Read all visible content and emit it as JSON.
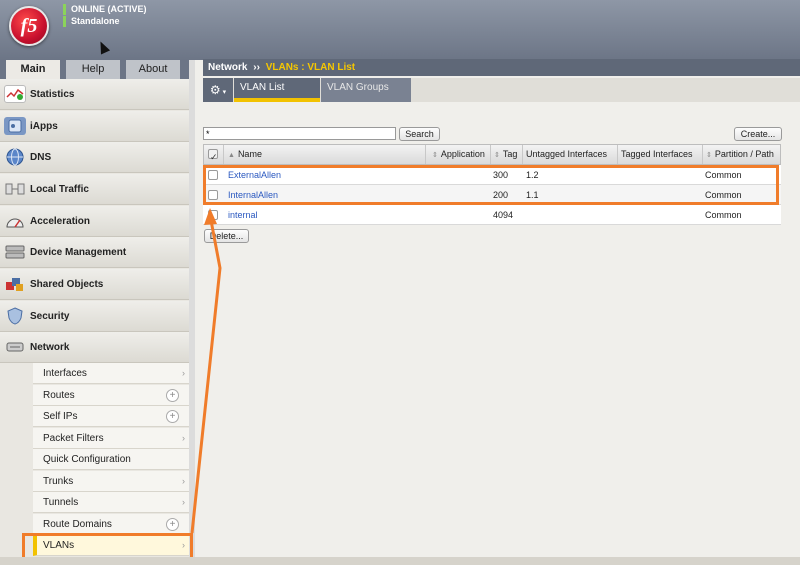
{
  "header": {
    "logo": "f5",
    "status_line1": "ONLINE (ACTIVE)",
    "status_line2": "Standalone"
  },
  "main_tabs": [
    {
      "label": "Main",
      "active": true
    },
    {
      "label": "Help",
      "active": false
    },
    {
      "label": "About",
      "active": false
    }
  ],
  "sidebar": {
    "items": [
      {
        "label": "Statistics",
        "icon": "chart-icon"
      },
      {
        "label": "iApps",
        "icon": "apps-icon"
      },
      {
        "label": "DNS",
        "icon": "globe-icon"
      },
      {
        "label": "Local Traffic",
        "icon": "traffic-icon"
      },
      {
        "label": "Acceleration",
        "icon": "gauge-icon"
      },
      {
        "label": "Device Management",
        "icon": "device-icon"
      },
      {
        "label": "Shared Objects",
        "icon": "shared-objects-icon"
      },
      {
        "label": "Security",
        "icon": "shield-icon"
      },
      {
        "label": "Network",
        "icon": "network-icon"
      }
    ],
    "network_submenu": [
      {
        "label": "Interfaces",
        "control": "arrow"
      },
      {
        "label": "Routes",
        "control": "plus"
      },
      {
        "label": "Self IPs",
        "control": "plus"
      },
      {
        "label": "Packet Filters",
        "control": "arrow"
      },
      {
        "label": "Quick Configuration",
        "control": "none"
      },
      {
        "label": "Trunks",
        "control": "arrow"
      },
      {
        "label": "Tunnels",
        "control": "arrow"
      },
      {
        "label": "Route Domains",
        "control": "plus"
      },
      {
        "label": "VLANs",
        "control": "arrow",
        "active": true
      }
    ]
  },
  "breadcrumb": {
    "section": "Network",
    "separator": "››",
    "page": "VLANs : VLAN List"
  },
  "subtabs": [
    {
      "label": "VLAN List",
      "active": true
    },
    {
      "label": "VLAN Groups",
      "active": false
    }
  ],
  "search": {
    "value": "*",
    "button": "Search"
  },
  "create_button": "Create...",
  "delete_button": "Delete...",
  "table": {
    "columns": [
      "Name",
      "Application",
      "Tag",
      "Untagged Interfaces",
      "Tagged Interfaces",
      "Partition / Path"
    ],
    "rows": [
      {
        "name": "ExternalAllen",
        "application": "",
        "tag": "300",
        "untagged": "1.2",
        "tagged": "",
        "partition": "Common"
      },
      {
        "name": "InternalAllen",
        "application": "",
        "tag": "200",
        "untagged": "1.1",
        "tagged": "",
        "partition": "Common"
      },
      {
        "name": "internal",
        "application": "",
        "tag": "4094",
        "untagged": "",
        "tagged": "",
        "partition": "Common"
      }
    ]
  },
  "colors": {
    "accent": "#f2c200",
    "highlight": "#f07c2a",
    "link": "#2a58c0",
    "banner": "#6c7586"
  }
}
